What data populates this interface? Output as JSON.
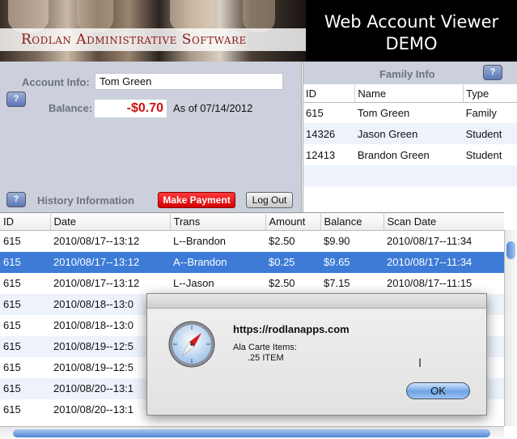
{
  "header": {
    "brand_name": "Rodlan Administrative Software",
    "title_line1": "Web Account Viewer",
    "title_line2": "DEMO"
  },
  "account": {
    "account_info_label": "Account Info:",
    "account_name": "Tom  Green",
    "help_label": "?",
    "balance_label": "Balance:",
    "balance_value": "-$0.70",
    "as_of": "As of 07/14/2012",
    "history_label": "History Information",
    "make_payment_label": "Make Payment",
    "log_out_label": "Log Out"
  },
  "family": {
    "title": "Family Info",
    "help_label": "?",
    "columns": [
      "ID",
      "Name",
      "Type"
    ],
    "rows": [
      [
        "615",
        "Tom Green",
        "Family"
      ],
      [
        "14326",
        "Jason Green",
        "Student"
      ],
      [
        "12413",
        "Brandon Green",
        "Student"
      ]
    ]
  },
  "history": {
    "columns": [
      "ID",
      "Date",
      "Trans",
      "Amount",
      "Balance",
      "Scan Date"
    ],
    "rows": [
      [
        "615",
        "2010/08/17--13:12",
        "L--Brandon",
        "$2.50",
        "$9.90",
        "2010/08/17--11:34"
      ],
      [
        "615",
        "2010/08/17--13:12",
        "A--Brandon",
        "$0.25",
        "$9.65",
        "2010/08/17--11:34"
      ],
      [
        "615",
        "2010/08/17--13:12",
        "L--Jason",
        "$2.50",
        "$7.15",
        "2010/08/17--11:15"
      ],
      [
        "615",
        "2010/08/18--13:0",
        "",
        "",
        "",
        ""
      ],
      [
        "615",
        "2010/08/18--13:0",
        "",
        "",
        "",
        ""
      ],
      [
        "615",
        "2010/08/19--12:5",
        "",
        "",
        "",
        ""
      ],
      [
        "615",
        "2010/08/19--12:5",
        "",
        "",
        "",
        ""
      ],
      [
        "615",
        "2010/08/20--13:1",
        "",
        "",
        "",
        ""
      ],
      [
        "615",
        "2010/08/20--13:1",
        "",
        "",
        "",
        ""
      ]
    ],
    "selected_row": 1
  },
  "dialog": {
    "origin": "https://rodlanapps.com",
    "message_line1": "Ala Carte Items:",
    "message_line2": ".25 ITEM",
    "ok_label": "OK"
  },
  "colors": {
    "panel_bg": "#cbd0dc",
    "balance_negative": "#d01010",
    "selection": "#3d7bd6",
    "payment_button": "#e00000"
  }
}
